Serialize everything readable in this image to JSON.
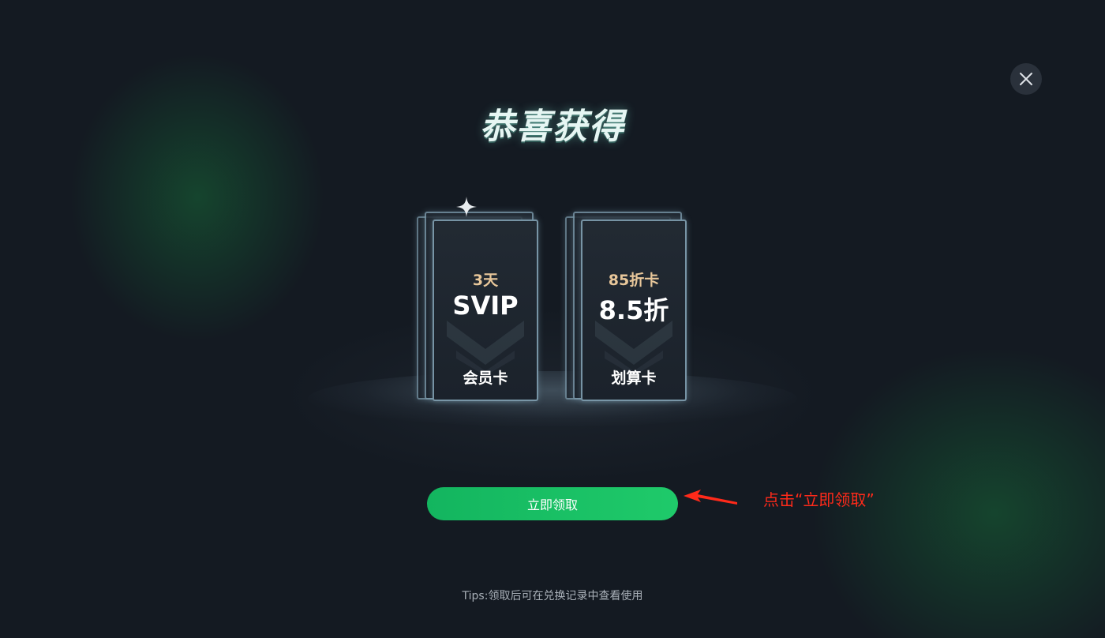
{
  "dialog": {
    "title": "恭喜获得",
    "tips": "Tips:领取后可在兑换记录中查看使用"
  },
  "cards": [
    {
      "sub": "3天",
      "main": "SVIP",
      "bottom": "会员卡"
    },
    {
      "sub": "85折卡",
      "main": "8.5折",
      "bottom": "划算卡"
    }
  ],
  "actions": {
    "claim_label": "立即领取"
  },
  "annotation": {
    "text": "点击“立即领取”",
    "color": "#ff2a1a"
  },
  "icons": {
    "close": "close-icon",
    "sparkle": "sparkle-icon",
    "arrow": "arrow-left-icon"
  },
  "colors": {
    "accent": "#1fca6a",
    "card_sub": "#e8c79a",
    "background": "#141a22"
  }
}
